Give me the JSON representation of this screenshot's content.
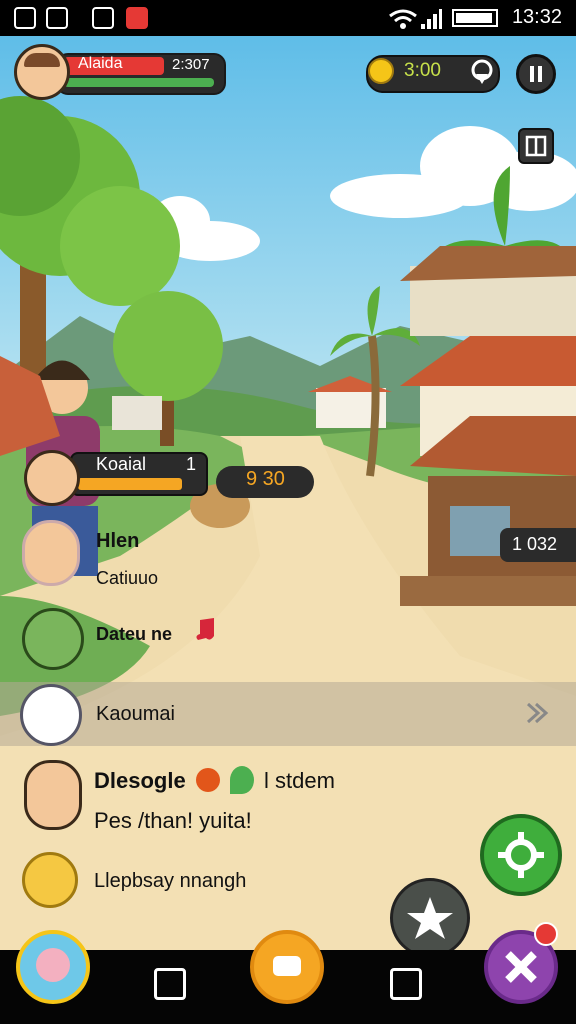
{
  "status_bar": {
    "time": "13:32"
  },
  "hud": {
    "player_name": "Alaida",
    "score": "2:307",
    "coins": "3:00"
  },
  "scene": {
    "npc_name": "Koaial",
    "npc_level": "1",
    "item_count": "9 30",
    "house_price": "1 032"
  },
  "chat": [
    {
      "name": "Hlen",
      "text": "Catiuuo"
    },
    {
      "name": "Dateu ne",
      "text": ""
    },
    {
      "name": "",
      "text": "Kaoumai"
    },
    {
      "name": "Dlesogle",
      "text": "l stdem"
    },
    {
      "name": "",
      "text": "Pes /than! yuita!"
    },
    {
      "name": "",
      "text": "Llepbsay nnangh"
    }
  ],
  "colors": {
    "sky": "#7ec9ec",
    "ground": "#f0dcae",
    "accent_green": "#4caf50",
    "accent_red": "#e53935",
    "accent_purple": "#8e44ad",
    "accent_orange": "#f5a623"
  },
  "icons": {
    "settings": "gear-icon",
    "star": "star-icon",
    "close": "close-icon",
    "pause": "pause-icon",
    "map": "map-pin-icon",
    "menu": "book-icon"
  }
}
